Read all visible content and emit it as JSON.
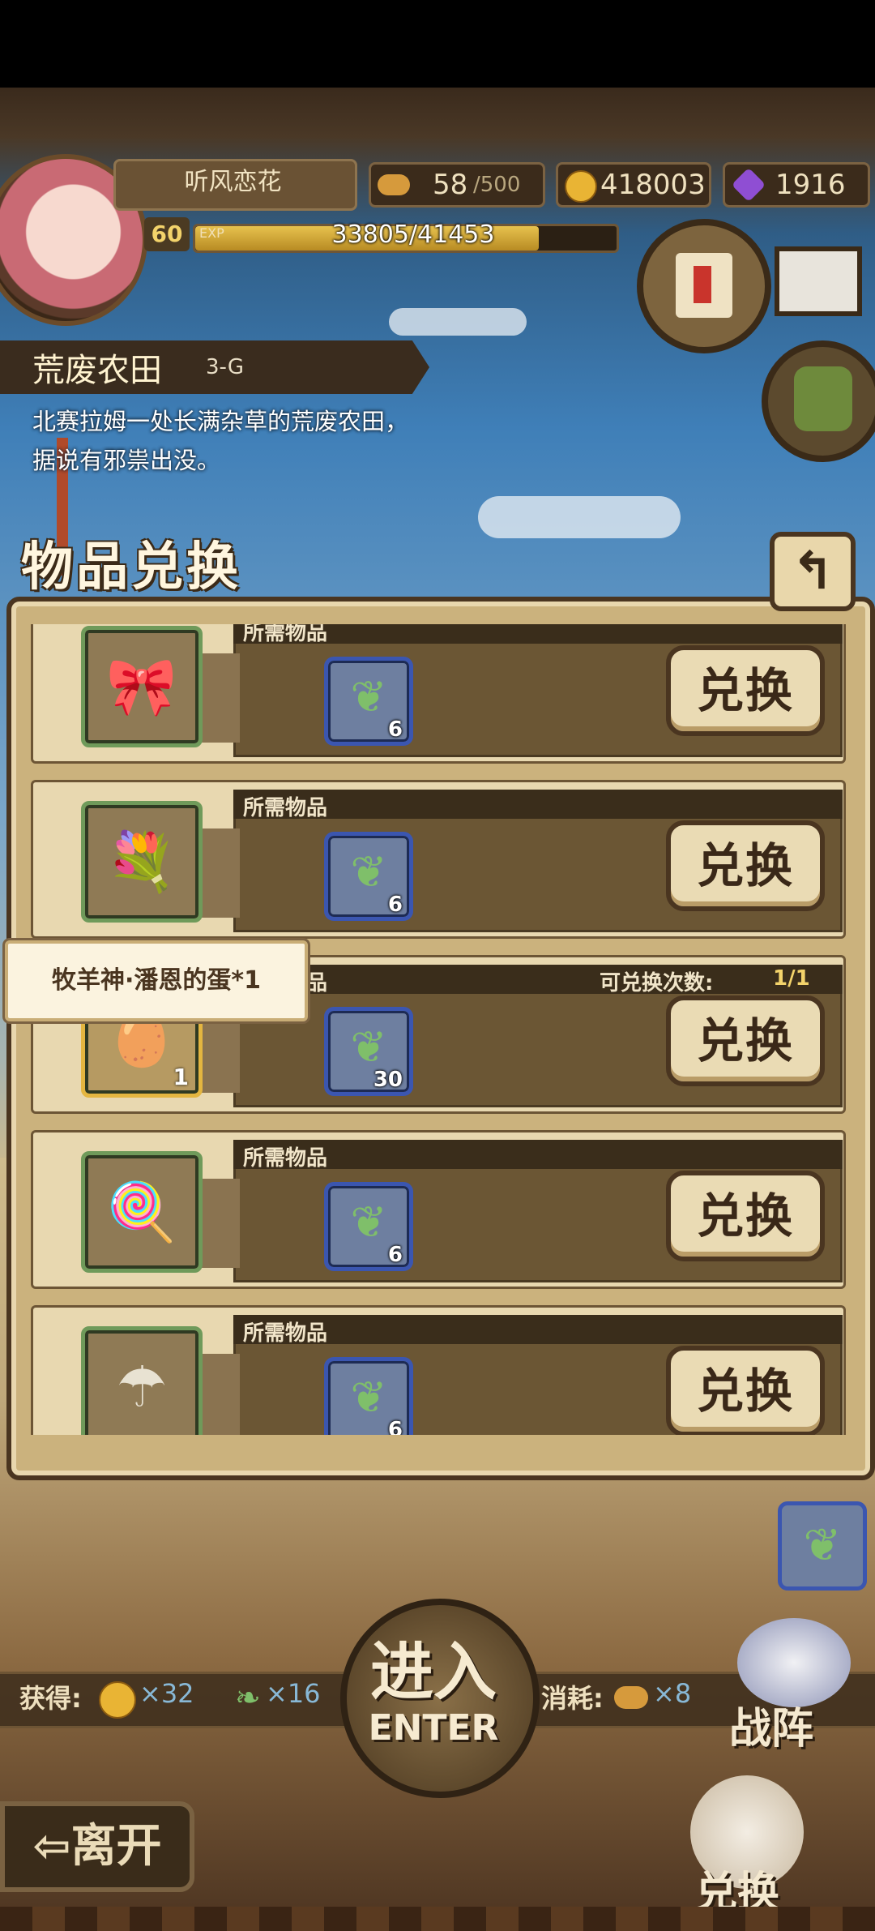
{
  "player": {
    "name": "听风恋花",
    "level": "60",
    "exp_label": "EXP",
    "exp_value": "33805/41453",
    "exp_fraction": 0.8155,
    "stamina": "58",
    "stamina_max": "/500",
    "gold": "418003",
    "gems": "1916"
  },
  "stage": {
    "name": "荒废农田",
    "code": "3-G",
    "description": "北赛拉姆一处长满杂草的荒废农田，据说有邪祟出没。"
  },
  "panel": {
    "title": "物品兑换",
    "back_icon": "return-arrow-icon",
    "required_label": "所需物品",
    "exchange_label": "兑换",
    "rows": [
      {
        "item_icon": "ribbon-charm-icon",
        "req_icon": "herb-leaf-icon",
        "req_qty": "6",
        "item_qty": "",
        "count_label": "",
        "count_value": ""
      },
      {
        "item_icon": "flower-bouquet-icon",
        "req_icon": "herb-leaf-icon",
        "req_qty": "6",
        "item_qty": "",
        "count_label": "",
        "count_value": ""
      },
      {
        "item_icon": "sheep-egg-icon",
        "req_icon": "herb-leaf-icon",
        "req_qty": "30",
        "item_qty": "1",
        "count_label": "可兑换次数:",
        "count_value": "1/1"
      },
      {
        "item_icon": "pink-lollipop-icon",
        "req_icon": "herb-leaf-icon",
        "req_qty": "6",
        "item_qty": "",
        "count_label": "",
        "count_value": ""
      },
      {
        "item_icon": "umbrella-icon",
        "req_icon": "herb-leaf-icon",
        "req_qty": "6",
        "item_qty": "",
        "count_label": "",
        "count_value": ""
      }
    ],
    "tooltip": "牧羊神·潘恩的蛋*1"
  },
  "rewards": {
    "obtain_label": "获得:",
    "gold_reward": "×32",
    "feather_reward": "×16",
    "consume_label": "消耗:",
    "stamina_cost": "×8"
  },
  "buttons": {
    "enter_cn": "进入",
    "enter_en": "ENTER",
    "leave": "离开",
    "formation": "战阵",
    "exchange": "兑换"
  },
  "colors": {
    "accent_gold": "#f3d36b",
    "required_blue": "#3b56b0",
    "slot_green": "#6f9a5a"
  }
}
